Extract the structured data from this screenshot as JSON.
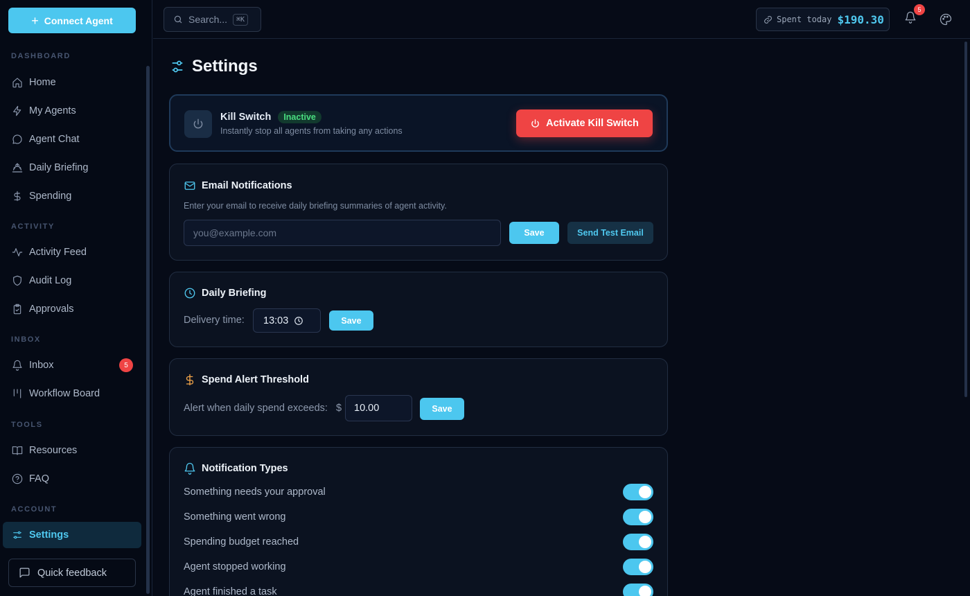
{
  "sidebar": {
    "connect_label": "Connect Agent",
    "sections": {
      "dashboard": "DASHBOARD",
      "activity": "ACTIVITY",
      "inbox": "INBOX",
      "tools": "TOOLS",
      "account": "ACCOUNT"
    },
    "items": {
      "home": "Home",
      "my_agents": "My Agents",
      "agent_chat": "Agent Chat",
      "daily_briefing": "Daily Briefing",
      "spending": "Spending",
      "activity_feed": "Activity Feed",
      "audit_log": "Audit Log",
      "approvals": "Approvals",
      "inbox": "Inbox",
      "inbox_count": "5",
      "workflow_board": "Workflow Board",
      "resources": "Resources",
      "faq": "FAQ",
      "settings": "Settings"
    },
    "active_item": "settings",
    "feedback_label": "Quick feedback"
  },
  "topbar": {
    "search_placeholder": "Search...",
    "search_shortcut": "⌘K",
    "spent_label": "Spent today",
    "spent_amount": "$190.30",
    "notification_count": "5"
  },
  "page": {
    "title": "Settings"
  },
  "kill_switch": {
    "title": "Kill Switch",
    "status": "Inactive",
    "description": "Instantly stop all agents from taking any actions",
    "button_label": "Activate Kill Switch"
  },
  "email": {
    "title": "Email Notifications",
    "hint": "Enter your email to receive daily briefing summaries of agent activity.",
    "placeholder": "you@example.com",
    "value": "",
    "save_label": "Save",
    "test_label": "Send Test Email"
  },
  "daily_briefing": {
    "title": "Daily Briefing",
    "delivery_label": "Delivery time:",
    "time_value": "13:03",
    "save_label": "Save"
  },
  "spend_alert": {
    "title": "Spend Alert Threshold",
    "label": "Alert when daily spend exceeds:",
    "currency": "$",
    "value": "10.00",
    "save_label": "Save"
  },
  "notification_types": {
    "title": "Notification Types",
    "items": [
      {
        "label": "Something needs your approval",
        "enabled": true
      },
      {
        "label": "Something went wrong",
        "enabled": true
      },
      {
        "label": "Spending budget reached",
        "enabled": true
      },
      {
        "label": "Agent stopped working",
        "enabled": true
      },
      {
        "label": "Agent finished a task",
        "enabled": true
      }
    ]
  },
  "colors": {
    "accent": "#4cc7ef",
    "danger": "#ef4444",
    "success": "#4ade80",
    "background": "#060b17",
    "spend_icon": "#f4a64a"
  }
}
